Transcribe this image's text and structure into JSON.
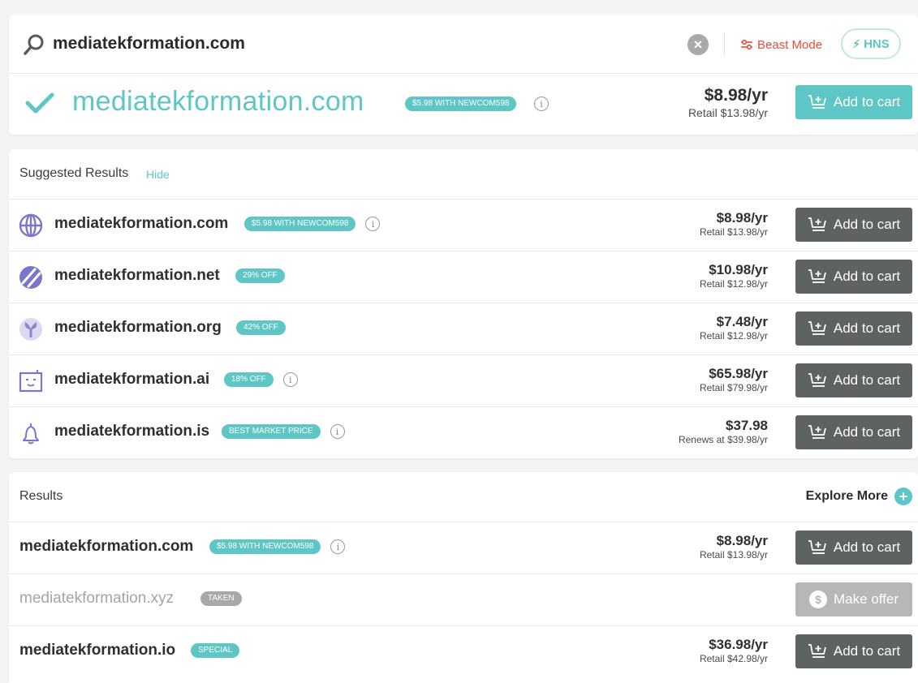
{
  "search": {
    "query": "mediatekformation.com",
    "clear_label": "×",
    "beast_mode_label": "Beast Mode",
    "hns_label": "HNS"
  },
  "main_result": {
    "domain": "mediatekformation.com",
    "badge": "$5.98 WITH NEWCOM598",
    "price": "$8.98/yr",
    "retail": "Retail $13.98/yr",
    "button": "Add to cart"
  },
  "suggested": {
    "title": "Suggested Results",
    "hide_label": "Hide",
    "rows": [
      {
        "domain": "mediatekformation.com",
        "badge": "$5.98 WITH NEWCOM598",
        "info": true,
        "price": "$8.98/yr",
        "retail": "Retail $13.98/yr",
        "button": "Add to cart",
        "icon": "globe-icon"
      },
      {
        "domain": "mediatekformation.net",
        "badge": "29% OFF",
        "info": false,
        "price": "$10.98/yr",
        "retail": "Retail $12.98/yr",
        "button": "Add to cart",
        "icon": "net-icon"
      },
      {
        "domain": "mediatekformation.org",
        "badge": "42% OFF",
        "info": false,
        "price": "$7.48/yr",
        "retail": "Retail $12.98/yr",
        "button": "Add to cart",
        "icon": "org-icon"
      },
      {
        "domain": "mediatekformation.ai",
        "badge": "18% OFF",
        "info": true,
        "price": "$65.98/yr",
        "retail": "Retail $79.98/yr",
        "button": "Add to cart",
        "icon": "robot-icon"
      },
      {
        "domain": "mediatekformation.is",
        "badge": "BEST MARKET PRICE",
        "info": true,
        "price": "$37.98",
        "retail": "Renews at $39.98/yr",
        "button": "Add to cart",
        "icon": "bell-icon"
      }
    ]
  },
  "results": {
    "title": "Results",
    "explore_label": "Explore More",
    "rows": [
      {
        "domain": "mediatekformation.com",
        "badge": "$5.98 WITH NEWCOM598",
        "info": true,
        "price": "$8.98/yr",
        "retail": "Retail $13.98/yr",
        "button": "Add to cart"
      },
      {
        "domain": "mediatekformation.xyz",
        "badge": "TAKEN",
        "info": false,
        "price": "",
        "retail": "",
        "button": "Make offer"
      },
      {
        "domain": "mediatekformation.io",
        "badge": "SPECIAL",
        "info": false,
        "price": "$36.98/yr",
        "retail": "Retail $42.98/yr",
        "button": "Add to cart"
      }
    ]
  },
  "colors": {
    "accent": "#5ec6c4",
    "beast": "#ea4b3b",
    "button_dark": "#5f6263",
    "button_disabled": "#b7b7b7"
  }
}
